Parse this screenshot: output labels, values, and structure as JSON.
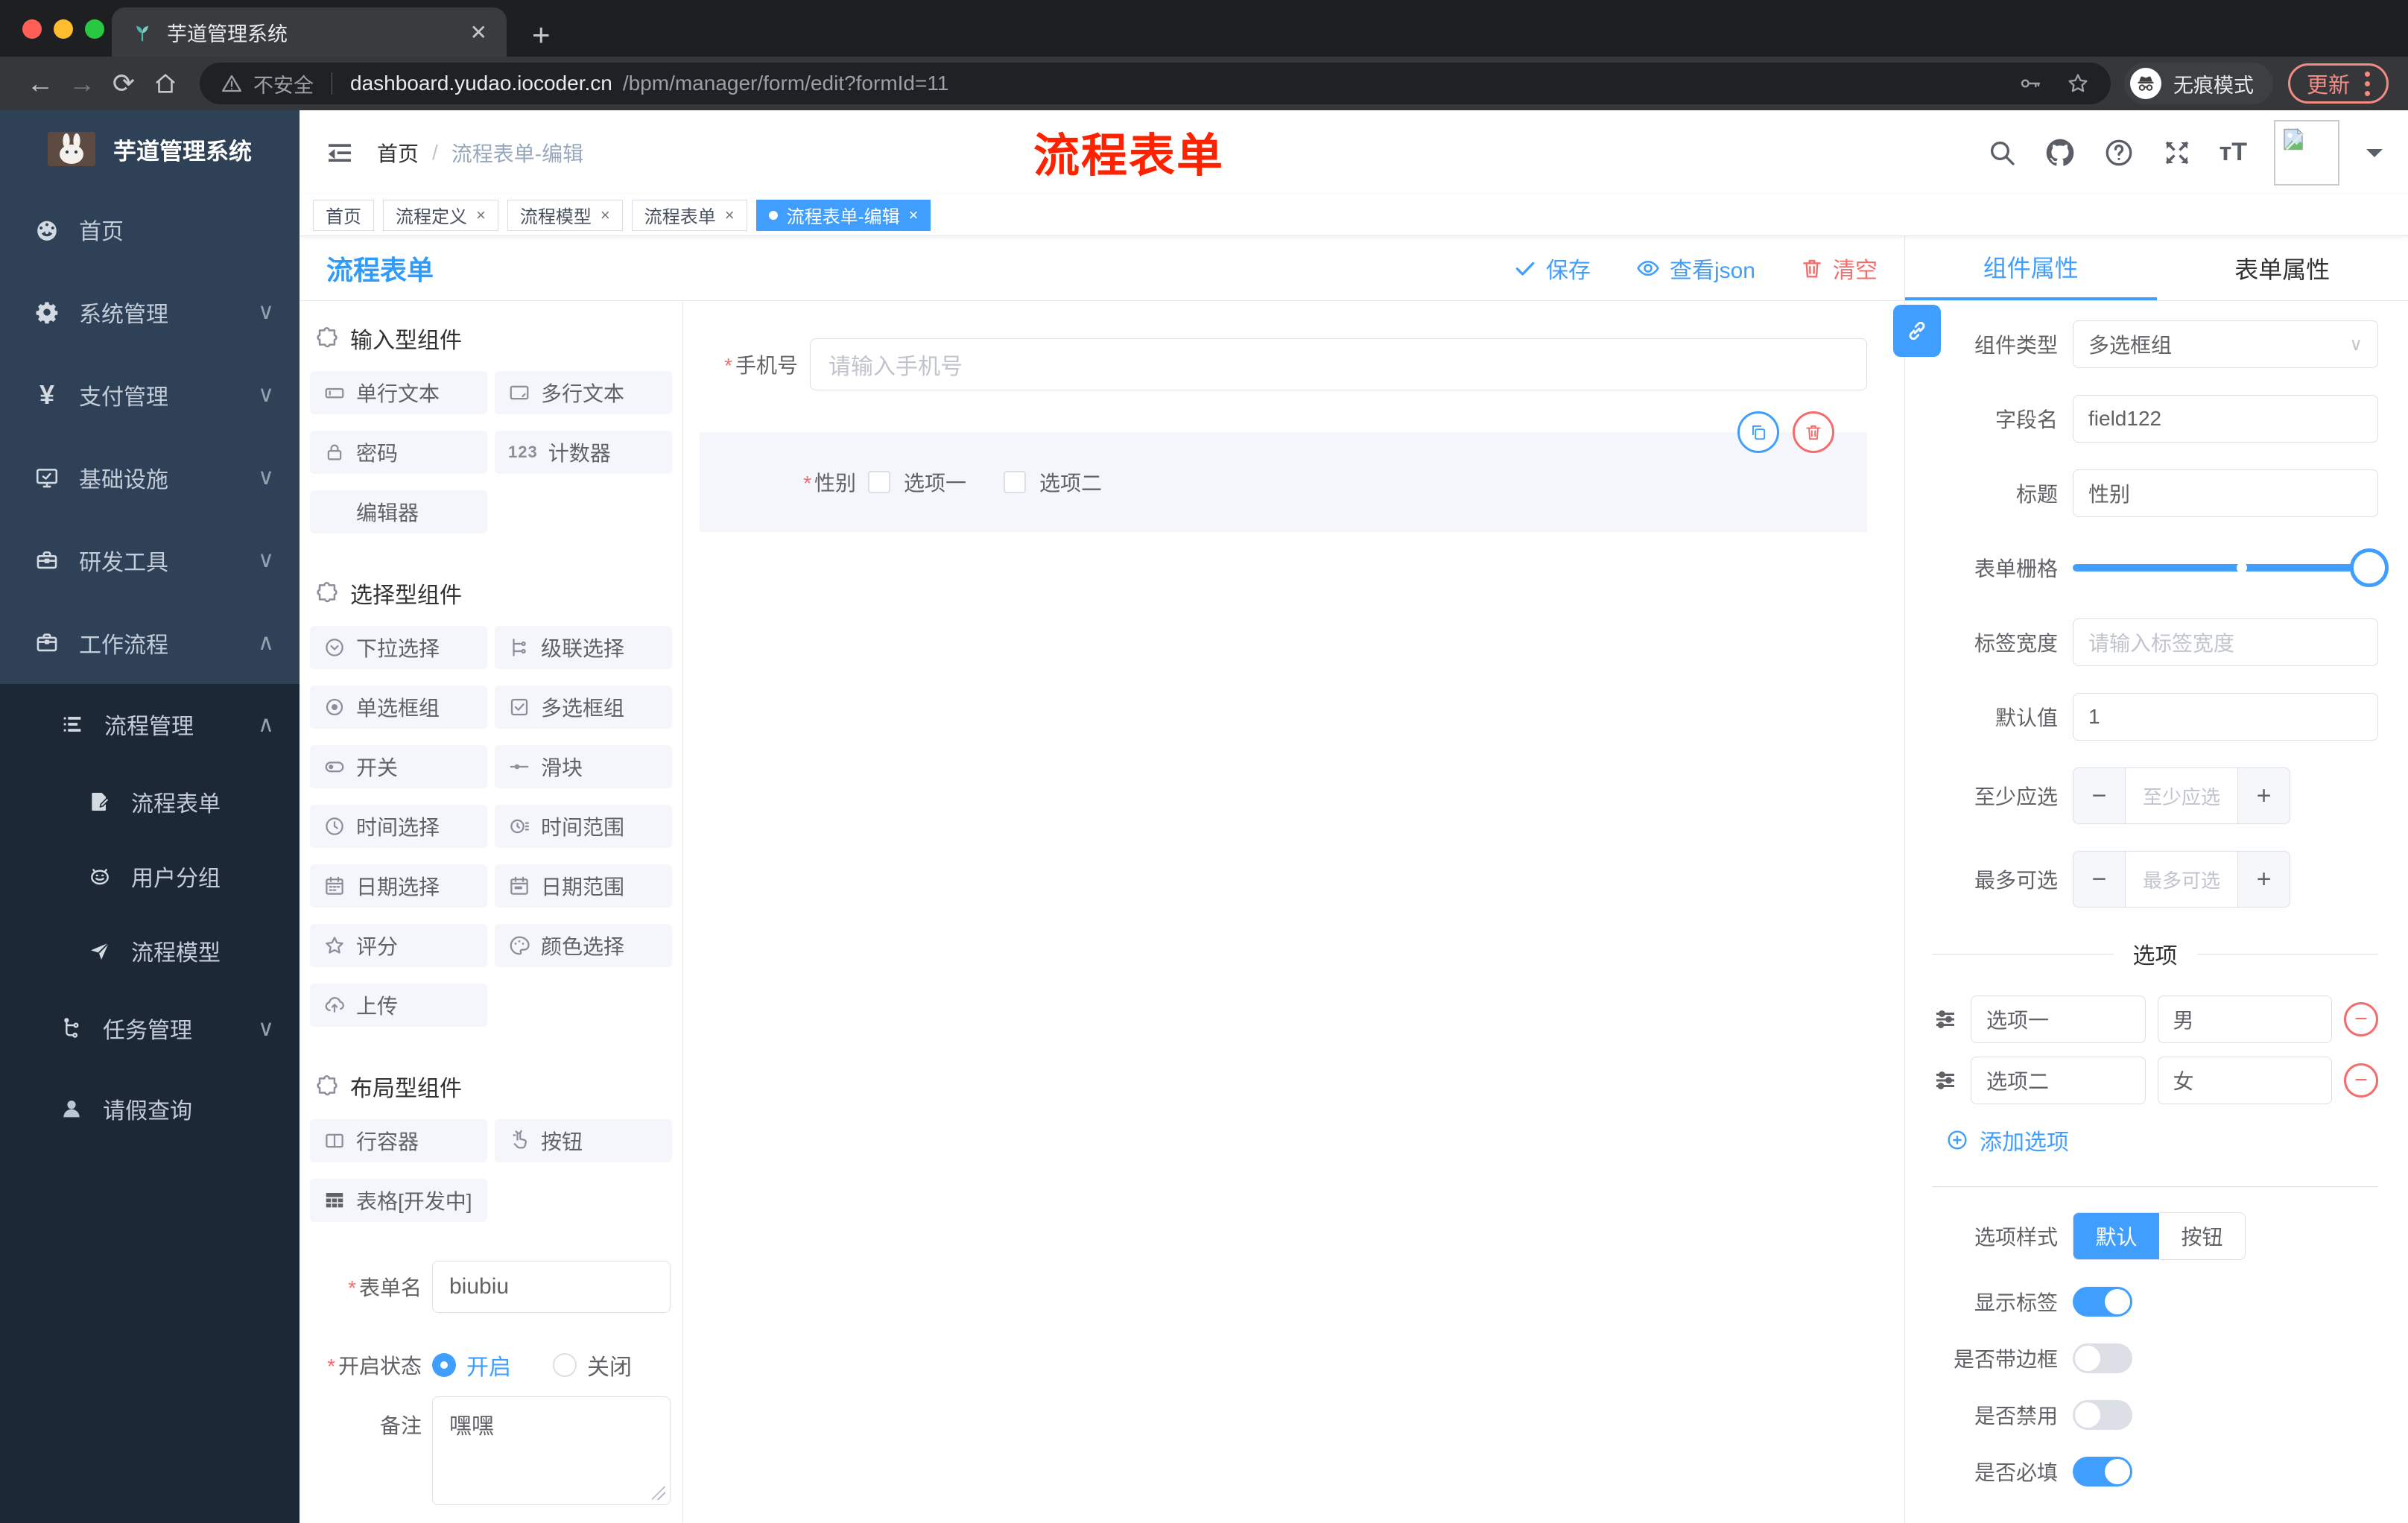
{
  "browser": {
    "tab_title": "芋道管理系统",
    "security": "不安全",
    "url_host": "dashboard.yudao.iocoder.cn",
    "url_path": "/bpm/manager/form/edit?formId=11",
    "incognito": "无痕模式",
    "update": "更新",
    "back": "←",
    "forward": "→",
    "reload": "⟳",
    "home": "⌂",
    "new_tab": "+",
    "close_tab": "✕"
  },
  "sidebar": {
    "brand": "芋道管理系统",
    "items": [
      {
        "label": "首页",
        "icon": "dashboard-icon",
        "level": 1
      },
      {
        "label": "系统管理",
        "icon": "gear-icon",
        "level": 1,
        "chevron": "∨"
      },
      {
        "label": "支付管理",
        "icon": "yen-icon",
        "level": 1,
        "chevron": "∨"
      },
      {
        "label": "基础设施",
        "icon": "monitor-icon",
        "level": 1,
        "chevron": "∨"
      },
      {
        "label": "研发工具",
        "icon": "toolbox-icon",
        "level": 1,
        "chevron": "∨"
      },
      {
        "label": "工作流程",
        "icon": "briefcase-icon",
        "level": 1,
        "chevron": "∧"
      },
      {
        "label": "流程管理",
        "icon": "list-icon",
        "level": 2,
        "chevron": "∧"
      },
      {
        "label": "流程表单",
        "icon": "form-edit-icon",
        "level": 3
      },
      {
        "label": "用户分组",
        "icon": "robot-icon",
        "level": 3
      },
      {
        "label": "流程模型",
        "icon": "paper-plane-icon",
        "level": 3
      },
      {
        "label": "任务管理",
        "icon": "flow-tree-icon",
        "level": 2,
        "chevron": "∨"
      },
      {
        "label": "请假查询",
        "icon": "user-icon",
        "level": 2
      }
    ]
  },
  "header": {
    "breadcrumb": {
      "home": "首页",
      "sep": "/",
      "current": "流程表单-编辑"
    },
    "annotation": "流程表单",
    "font_size_icon_text": "тT"
  },
  "tags": [
    {
      "label": "首页"
    },
    {
      "label": "流程定义",
      "close": "×"
    },
    {
      "label": "流程模型",
      "close": "×"
    },
    {
      "label": "流程表单",
      "close": "×"
    },
    {
      "label": "流程表单-编辑",
      "close": "×",
      "active": true
    }
  ],
  "designer": {
    "title": "流程表单",
    "actions": {
      "save": "保存",
      "view_json": "查看json",
      "clear": "清空"
    },
    "palette": {
      "sections": [
        {
          "title": "输入型组件",
          "items": [
            {
              "label": "单行文本",
              "icon": "input-icon"
            },
            {
              "label": "多行文本",
              "icon": "textarea-icon"
            },
            {
              "label": "密码",
              "icon": "lock-icon"
            },
            {
              "label": "计数器",
              "icon": "number-123-icon"
            },
            {
              "label": "编辑器",
              "icon": "none"
            }
          ]
        },
        {
          "title": "选择型组件",
          "items": [
            {
              "label": "下拉选择",
              "icon": "select-icon"
            },
            {
              "label": "级联选择",
              "icon": "cascader-icon"
            },
            {
              "label": "单选框组",
              "icon": "radio-icon"
            },
            {
              "label": "多选框组",
              "icon": "checkbox-icon"
            },
            {
              "label": "开关",
              "icon": "switch-icon"
            },
            {
              "label": "滑块",
              "icon": "slider-icon"
            },
            {
              "label": "时间选择",
              "icon": "time-icon"
            },
            {
              "label": "时间范围",
              "icon": "time-range-icon"
            },
            {
              "label": "日期选择",
              "icon": "date-icon"
            },
            {
              "label": "日期范围",
              "icon": "date-range-icon"
            },
            {
              "label": "评分",
              "icon": "star-icon"
            },
            {
              "label": "颜色选择",
              "icon": "palette-icon"
            },
            {
              "label": "上传",
              "icon": "upload-icon"
            }
          ]
        },
        {
          "title": "布局型组件",
          "items": [
            {
              "label": "行容器",
              "icon": "columns-icon"
            },
            {
              "label": "按钮",
              "icon": "hand-click-icon"
            },
            {
              "label": "表格[开发中]",
              "icon": "table-icon"
            }
          ]
        }
      ]
    },
    "meta": {
      "form_name_label": "表单名",
      "form_name_value": "biubiu",
      "status_label": "开启状态",
      "status_on": "开启",
      "status_off": "关闭",
      "remark_label": "备注",
      "remark_value": "嘿嘿"
    }
  },
  "canvas": {
    "phone": {
      "label": "手机号",
      "placeholder": "请输入手机号"
    },
    "gender": {
      "label": "性别",
      "option1": "选项一",
      "option2": "选项二"
    }
  },
  "props": {
    "tab_component": "组件属性",
    "tab_form": "表单属性",
    "component_type": {
      "label": "组件类型",
      "value": "多选框组"
    },
    "field_name": {
      "label": "字段名",
      "value": "field122"
    },
    "title": {
      "label": "标题",
      "value": "性别"
    },
    "grid": {
      "label": "表单栅格"
    },
    "label_width": {
      "label": "标签宽度",
      "placeholder": "请输入标签宽度"
    },
    "default_value": {
      "label": "默认值",
      "value": "1"
    },
    "min_select": {
      "label": "至少应选",
      "placeholder": "至少应选"
    },
    "max_select": {
      "label": "最多可选",
      "placeholder": "最多可选"
    },
    "options_title": "选项",
    "options": [
      {
        "label": "选项一",
        "value": "男"
      },
      {
        "label": "选项二",
        "value": "女"
      }
    ],
    "add_option": "添加选项",
    "option_style": {
      "label": "选项样式",
      "choice_default": "默认",
      "choice_button": "按钮",
      "selected": "默认"
    },
    "switch_show_label": {
      "label": "显示标签",
      "on": true
    },
    "switch_border": {
      "label": "是否带边框",
      "on": false
    },
    "switch_disabled": {
      "label": "是否禁用",
      "on": false
    },
    "switch_required": {
      "label": "是否必填",
      "on": true
    }
  },
  "colors": {
    "accent": "#409EFF",
    "danger": "#F56C6C",
    "annotation_red": "#FF2200",
    "sidebar_bg": "#2F4156",
    "sidebar_sub_bg": "#1D2836",
    "active_tag_bg": "#409EFF",
    "chrome_update": "#F28B82",
    "palette_item_bg": "#F4F6FC"
  }
}
